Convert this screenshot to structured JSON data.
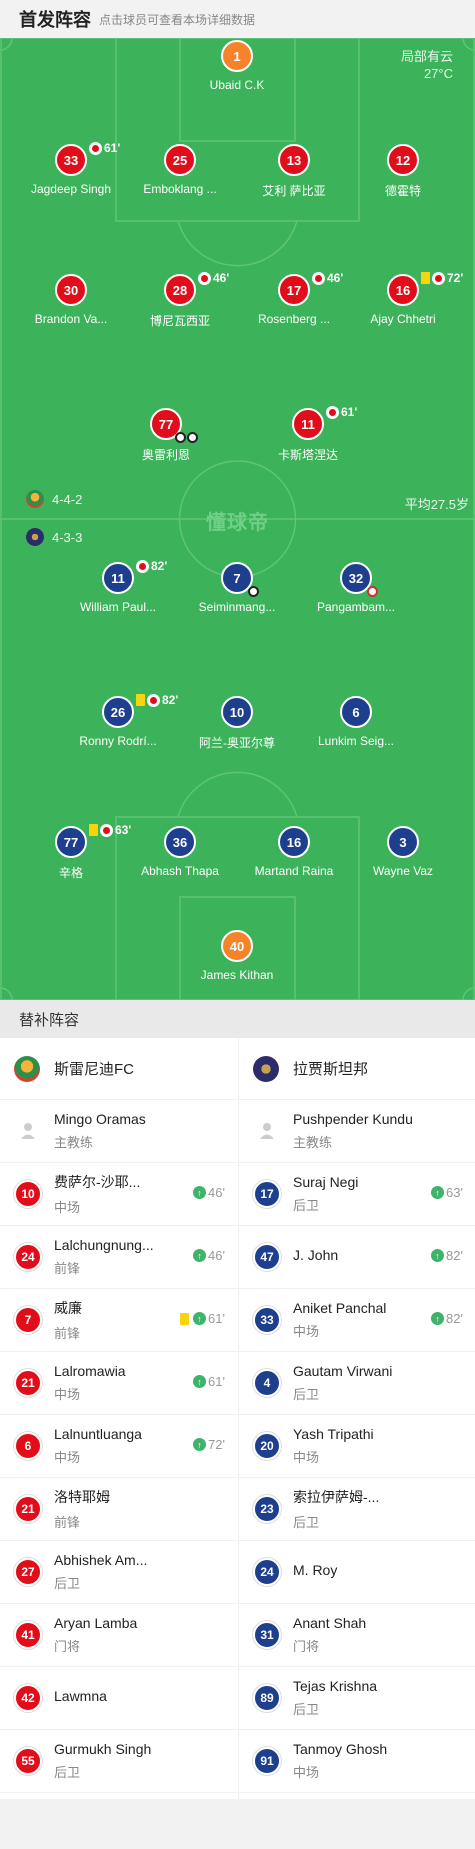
{
  "header": {
    "title": "首发阵容",
    "hint": "点击球员可查看本场详细数据"
  },
  "weather": {
    "condition": "局部有云",
    "temp": "27°C"
  },
  "watermark": "懂球帝",
  "home": {
    "formation": "4-4-2",
    "avg_age": "平均27.5岁",
    "gk": {
      "number": "1",
      "name": "Ubaid C.K"
    },
    "defenders": [
      {
        "number": "33",
        "name": "Jagdeep Singh",
        "sub_min": "61'"
      },
      {
        "number": "25",
        "name": "Emboklang ..."
      },
      {
        "number": "13",
        "name": "艾利 萨比亚"
      },
      {
        "number": "12",
        "name": "德霍特"
      }
    ],
    "midfielders": [
      {
        "number": "30",
        "name": "Brandon Va..."
      },
      {
        "number": "28",
        "name": "博尼瓦西亚",
        "sub_min": "46'"
      },
      {
        "number": "17",
        "name": "Rosenberg ...",
        "sub_min": "46'"
      },
      {
        "number": "16",
        "name": "Ajay Chhetri",
        "sub_min": "72'"
      }
    ],
    "forwards": [
      {
        "number": "77",
        "name": "奥雷利恩"
      },
      {
        "number": "11",
        "name": "卡斯塔涅达",
        "sub_min": "61'"
      }
    ]
  },
  "away": {
    "formation": "4-3-3",
    "forwards": [
      {
        "number": "11",
        "name": "William Paul...",
        "sub_min": "82'"
      },
      {
        "number": "7",
        "name": "Seiminmang..."
      },
      {
        "number": "32",
        "name": "Pangambam..."
      }
    ],
    "midfielders": [
      {
        "number": "26",
        "name": "Ronny Rodrí...",
        "sub_min": "82'"
      },
      {
        "number": "10",
        "name": "阿兰-奥亚尔尊"
      },
      {
        "number": "6",
        "name": "Lunkim Seig..."
      }
    ],
    "defenders": [
      {
        "number": "77",
        "name": "辛格",
        "sub_min": "63'"
      },
      {
        "number": "36",
        "name": "Abhash Thapa"
      },
      {
        "number": "16",
        "name": "Martand Raina"
      },
      {
        "number": "3",
        "name": "Wayne Vaz"
      }
    ],
    "gk": {
      "number": "40",
      "name": "James Kithan"
    }
  },
  "subs": {
    "title": "替补阵容",
    "home_team": "斯雷尼迪FC",
    "away_team": "拉贾斯坦邦",
    "home_coach": {
      "name": "Mingo Oramas",
      "role": "主教练"
    },
    "away_coach": {
      "name": "Pushpender Kundu",
      "role": "主教练"
    },
    "home": [
      {
        "number": "10",
        "name": "费萨尔-沙耶...",
        "pos": "中场",
        "in": "46'"
      },
      {
        "number": "24",
        "name": "Lalchungnung...",
        "pos": "前锋",
        "in": "46'"
      },
      {
        "number": "7",
        "name": "威廉",
        "pos": "前锋",
        "in": "61'"
      },
      {
        "number": "21",
        "name": "Lalromawia",
        "pos": "中场",
        "in": "61'"
      },
      {
        "number": "6",
        "name": "Lalnuntluanga",
        "pos": "中场",
        "in": "72'"
      },
      {
        "number": "21",
        "name": "洛特耶姆",
        "pos": "前锋"
      },
      {
        "number": "27",
        "name": "Abhishek Am...",
        "pos": "后卫"
      },
      {
        "number": "41",
        "name": "Aryan Lamba",
        "pos": "门将"
      },
      {
        "number": "42",
        "name": "Lawmna",
        "pos": ""
      },
      {
        "number": "55",
        "name": "Gurmukh Singh",
        "pos": "后卫"
      }
    ],
    "away": [
      {
        "number": "17",
        "name": "Suraj Negi",
        "pos": "后卫",
        "in": "63'"
      },
      {
        "number": "47",
        "name": "J. John",
        "pos": "",
        "in": "82'"
      },
      {
        "number": "33",
        "name": "Aniket Panchal",
        "pos": "中场",
        "in": "82'"
      },
      {
        "number": "4",
        "name": "Gautam Virwani",
        "pos": "后卫"
      },
      {
        "number": "20",
        "name": "Yash Tripathi",
        "pos": "中场"
      },
      {
        "number": "23",
        "name": "索拉伊萨姆-...",
        "pos": "后卫"
      },
      {
        "number": "24",
        "name": "M. Roy",
        "pos": ""
      },
      {
        "number": "31",
        "name": "Anant Shah",
        "pos": "门将"
      },
      {
        "number": "89",
        "name": "Tejas Krishna",
        "pos": "后卫"
      },
      {
        "number": "91",
        "name": "Tanmoy Ghosh",
        "pos": "中场"
      }
    ]
  }
}
